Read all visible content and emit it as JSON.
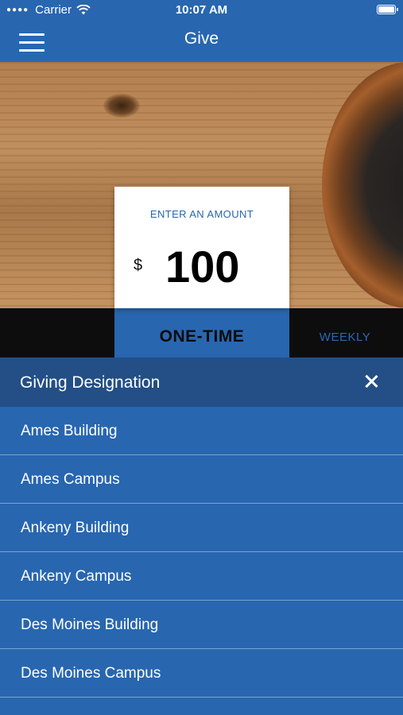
{
  "status_bar": {
    "carrier": "Carrier",
    "time": "10:07 AM"
  },
  "nav": {
    "title": "Give",
    "menu_icon": "hamburger-icon"
  },
  "amount": {
    "label": "ENTER AN AMOUNT",
    "currency": "$",
    "value": "100"
  },
  "frequency_tabs": {
    "one_time": "ONE-TIME",
    "weekly": "WEEKLY",
    "selected": "one_time"
  },
  "designation": {
    "title": "Giving Designation",
    "close_icon": "close-icon",
    "items": [
      "Ames Building",
      "Ames Campus",
      "Ankeny Building",
      "Ankeny Campus",
      "Des Moines Building",
      "Des Moines Campus"
    ]
  },
  "colors": {
    "brand_blue": "#2866b0",
    "sheet_header": "#234f86",
    "divider": "#7ea2cf"
  }
}
